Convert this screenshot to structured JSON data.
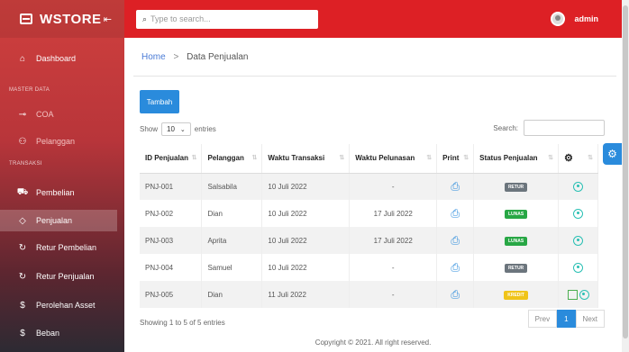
{
  "brand": {
    "name": "WSTORE",
    "collapse_icon": "collapse-icon"
  },
  "topbar": {
    "search_placeholder": "Type to search...",
    "username": "admin"
  },
  "sidebar": {
    "dashboard": "Dashboard",
    "section_master": "MASTER DATA",
    "coa": "COA",
    "pelanggan": "Pelanggan",
    "section_transaksi": "TRANSAKSI",
    "pembelian": "Pembelian",
    "penjualan": "Penjualan",
    "retur_pembelian": "Retur Pembelian",
    "retur_penjualan": "Retur Penjualan",
    "perolehan_asset": "Perolehan Asset",
    "beban": "Beban"
  },
  "breadcrumb": {
    "home": "Home",
    "sep": ">",
    "current": "Data Penjualan"
  },
  "toolbar": {
    "tambah": "Tambah"
  },
  "table_controls": {
    "show_label": "Show",
    "show_value": "10",
    "entries_label": "entries",
    "search_label": "Search:"
  },
  "table": {
    "headers": [
      "ID Penjualan",
      "Pelanggan",
      "Waktu Transaksi",
      "Waktu Pelunasan",
      "Print",
      "Status Penjualan"
    ],
    "rows": [
      {
        "id": "PNJ-001",
        "pelanggan": "Salsabila",
        "waktu_transaksi": "10 Juli 2022",
        "waktu_pelunasan": "-",
        "status": "RETUR",
        "status_color": "#6c757d"
      },
      {
        "id": "PNJ-002",
        "pelanggan": "Dian",
        "waktu_transaksi": "10 Juli 2022",
        "waktu_pelunasan": "17 Juli 2022",
        "status": "LUNAS",
        "status_color": "#28a745"
      },
      {
        "id": "PNJ-003",
        "pelanggan": "Aprita",
        "waktu_transaksi": "10 Juli 2022",
        "waktu_pelunasan": "17 Juli 2022",
        "status": "LUNAS",
        "status_color": "#28a745"
      },
      {
        "id": "PNJ-004",
        "pelanggan": "Samuel",
        "waktu_transaksi": "10 Juli 2022",
        "waktu_pelunasan": "-",
        "status": "RETUR",
        "status_color": "#6c757d"
      },
      {
        "id": "PNJ-005",
        "pelanggan": "Dian",
        "waktu_transaksi": "11 Juli 2022",
        "waktu_pelunasan": "-",
        "status": "KREDIT",
        "status_color": "#f0c419"
      }
    ]
  },
  "table_info": "Showing 1 to 5 of 5 entries",
  "pagination": {
    "prev": "Prev",
    "page": "1",
    "next": "Next"
  },
  "footer": "Copyright © 2021. All right reserved."
}
